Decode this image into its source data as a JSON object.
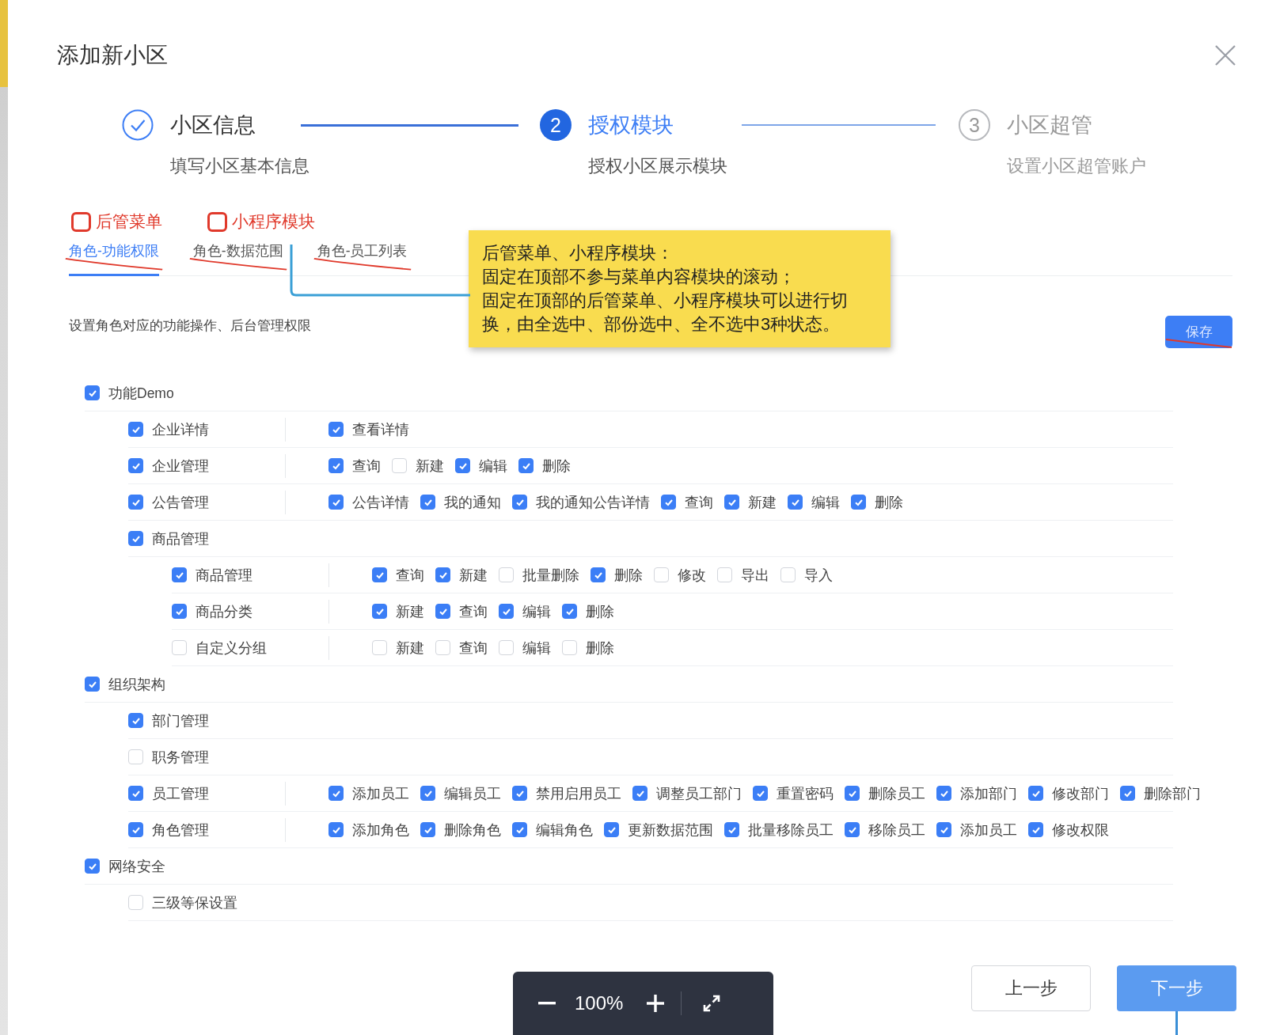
{
  "dialog": {
    "title": "添加新小区"
  },
  "steps": [
    {
      "title": "小区信息",
      "description": "填写小区基本信息",
      "kind": "finish"
    },
    {
      "title": "授权模块",
      "description": "授权小区展示模块",
      "kind": "process",
      "number": "2"
    },
    {
      "title": "小区超管",
      "description": "设置小区超管账户",
      "kind": "wait",
      "number": "3"
    }
  ],
  "annotations": [
    {
      "label": "后管菜单"
    },
    {
      "label": "小程序模块"
    }
  ],
  "tabs": [
    {
      "label": "角色-功能权限",
      "selected": true
    },
    {
      "label": "角色-数据范围",
      "selected": false
    },
    {
      "label": "角色-员工列表",
      "selected": false
    }
  ],
  "note": {
    "lines": [
      "后管菜单、小程序模块：",
      "固定在顶部不参与菜单内容模块的滚动；",
      "固定在顶部的后管菜单、小程序模块可以进行切换，由全选中、部份选中、全不选中3种状态。"
    ]
  },
  "description": "设置角色对应的功能操作、后台管理权限",
  "save_button": "保存",
  "tree": [
    {
      "label": "功能Demo",
      "checked": true,
      "children": [
        {
          "label": "企业详情",
          "checked": true,
          "actions": [
            {
              "label": "查看详情",
              "checked": true
            }
          ]
        },
        {
          "label": "企业管理",
          "checked": true,
          "actions": [
            {
              "label": "查询",
              "checked": true
            },
            {
              "label": "新建",
              "checked": false
            },
            {
              "label": "编辑",
              "checked": true
            },
            {
              "label": "删除",
              "checked": true
            }
          ]
        },
        {
          "label": "公告管理",
          "checked": true,
          "actions": [
            {
              "label": "公告详情",
              "checked": true
            },
            {
              "label": "我的通知",
              "checked": true
            },
            {
              "label": "我的通知公告详情",
              "checked": true
            },
            {
              "label": "查询",
              "checked": true
            },
            {
              "label": "新建",
              "checked": true
            },
            {
              "label": "编辑",
              "checked": true
            },
            {
              "label": "删除",
              "checked": true
            }
          ]
        },
        {
          "label": "商品管理",
          "checked": true,
          "children": [
            {
              "label": "商品管理",
              "checked": true,
              "actions": [
                {
                  "label": "查询",
                  "checked": true
                },
                {
                  "label": "新建",
                  "checked": true
                },
                {
                  "label": "批量删除",
                  "checked": false
                },
                {
                  "label": "删除",
                  "checked": true
                },
                {
                  "label": "修改",
                  "checked": false
                },
                {
                  "label": "导出",
                  "checked": false
                },
                {
                  "label": "导入",
                  "checked": false
                }
              ]
            },
            {
              "label": "商品分类",
              "checked": true,
              "actions": [
                {
                  "label": "新建",
                  "checked": true
                },
                {
                  "label": "查询",
                  "checked": true
                },
                {
                  "label": "编辑",
                  "checked": true
                },
                {
                  "label": "删除",
                  "checked": true
                }
              ]
            },
            {
              "label": "自定义分组",
              "checked": false,
              "actions": [
                {
                  "label": "新建",
                  "checked": false
                },
                {
                  "label": "查询",
                  "checked": false
                },
                {
                  "label": "编辑",
                  "checked": false
                },
                {
                  "label": "删除",
                  "checked": false
                }
              ]
            }
          ]
        }
      ]
    },
    {
      "label": "组织架构",
      "checked": true,
      "children": [
        {
          "label": "部门管理",
          "checked": true
        },
        {
          "label": "职务管理",
          "checked": false
        },
        {
          "label": "员工管理",
          "checked": true,
          "actions": [
            {
              "label": "添加员工",
              "checked": true
            },
            {
              "label": "编辑员工",
              "checked": true
            },
            {
              "label": "禁用启用员工",
              "checked": true
            },
            {
              "label": "调整员工部门",
              "checked": true
            },
            {
              "label": "重置密码",
              "checked": true
            },
            {
              "label": "删除员工",
              "checked": true
            },
            {
              "label": "添加部门",
              "checked": true
            },
            {
              "label": "修改部门",
              "checked": true
            },
            {
              "label": "删除部门",
              "checked": true
            }
          ]
        },
        {
          "label": "角色管理",
          "checked": true,
          "actions": [
            {
              "label": "添加角色",
              "checked": true
            },
            {
              "label": "删除角色",
              "checked": true
            },
            {
              "label": "编辑角色",
              "checked": true
            },
            {
              "label": "更新数据范围",
              "checked": true
            },
            {
              "label": "批量移除员工",
              "checked": true
            },
            {
              "label": "移除员工",
              "checked": true
            },
            {
              "label": "添加员工",
              "checked": true
            },
            {
              "label": "修改权限",
              "checked": true
            }
          ]
        }
      ]
    },
    {
      "label": "网络安全",
      "checked": true,
      "children": [
        {
          "label": "三级等保设置",
          "checked": false
        }
      ]
    }
  ],
  "footer": {
    "prev": "上一步",
    "next": "下一步"
  },
  "zoom_bar": {
    "zoom": "100%"
  }
}
